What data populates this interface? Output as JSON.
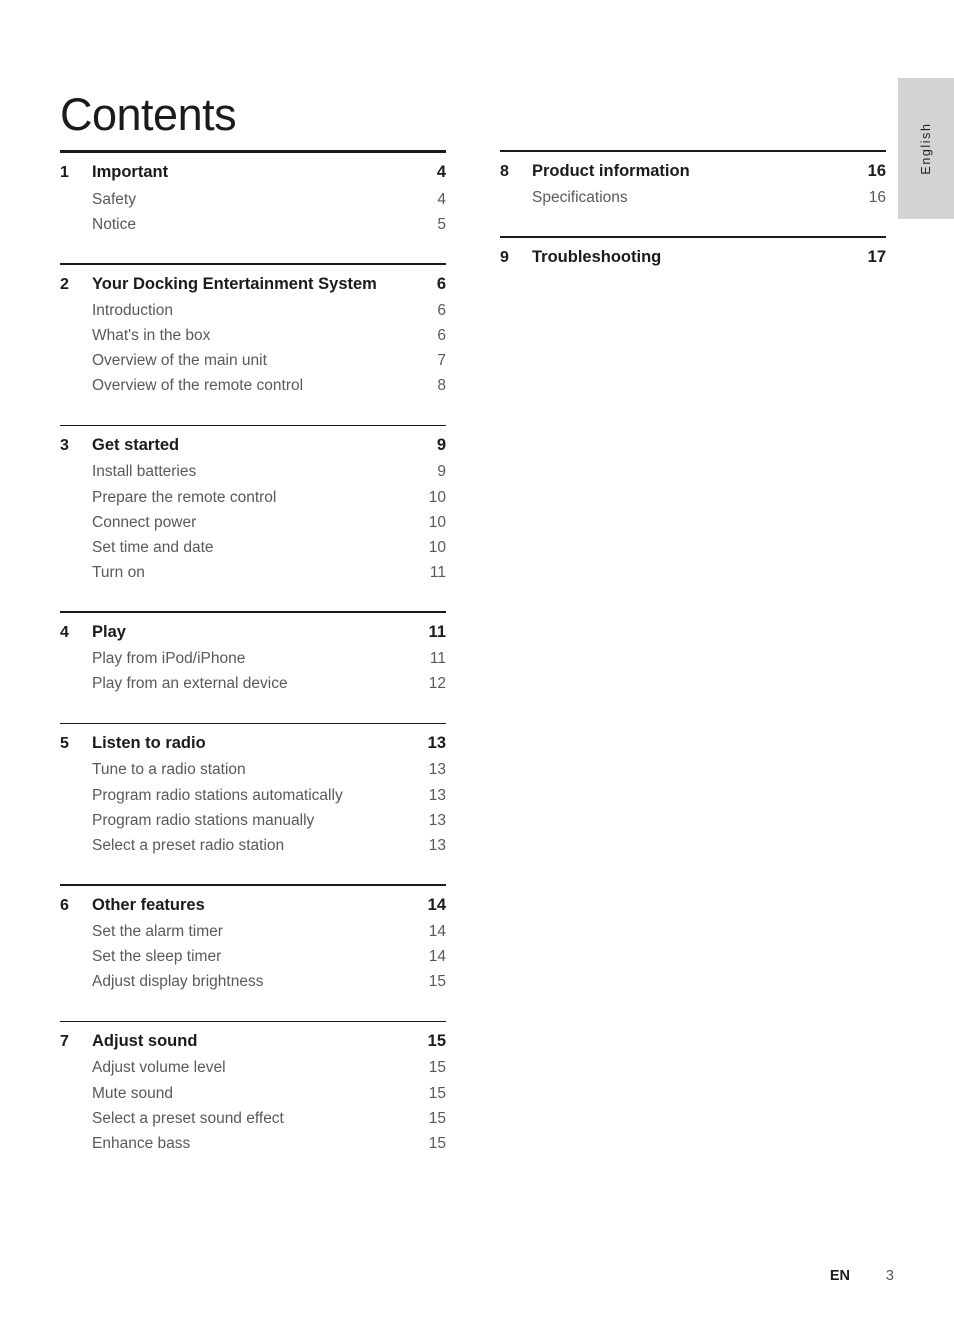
{
  "title": "Contents",
  "language_tab": {
    "label": "English"
  },
  "footer": {
    "lang_code": "EN",
    "page_number": "3"
  },
  "columns": {
    "left": [
      {
        "rule": "thick",
        "number": "1",
        "title": "Important",
        "page": "4",
        "items": [
          {
            "label": "Safety",
            "page": "4"
          },
          {
            "label": "Notice",
            "page": "5"
          }
        ]
      },
      {
        "rule": "thin",
        "number": "2",
        "title": "Your Docking Entertainment System",
        "page": "6",
        "tight": true,
        "items": [
          {
            "label": "Introduction",
            "page": "6"
          },
          {
            "label": "What's in the box",
            "page": "6"
          },
          {
            "label": "Overview of the main unit",
            "page": "7"
          },
          {
            "label": "Overview of the remote control",
            "page": "8"
          }
        ]
      },
      {
        "rule": "thin",
        "number": "3",
        "title": "Get started",
        "page": "9",
        "items": [
          {
            "label": "Install batteries",
            "page": "9"
          },
          {
            "label": "Prepare the remote control",
            "page": "10"
          },
          {
            "label": "Connect power",
            "page": "10"
          },
          {
            "label": "Set time and date",
            "page": "10"
          },
          {
            "label": "Turn on",
            "page": "11"
          }
        ]
      },
      {
        "rule": "thin",
        "number": "4",
        "title": "Play",
        "page": "11",
        "items": [
          {
            "label": "Play from iPod/iPhone",
            "page": "11"
          },
          {
            "label": "Play from an external device",
            "page": "12"
          }
        ]
      },
      {
        "rule": "thin",
        "number": "5",
        "title": "Listen to radio",
        "page": "13",
        "items": [
          {
            "label": "Tune to a radio station",
            "page": "13"
          },
          {
            "label": "Program radio stations automatically",
            "page": "13"
          },
          {
            "label": "Program radio stations manually",
            "page": "13"
          },
          {
            "label": "Select a preset radio station",
            "page": "13"
          }
        ]
      },
      {
        "rule": "thin",
        "number": "6",
        "title": "Other features",
        "page": "14",
        "items": [
          {
            "label": "Set the alarm timer",
            "page": "14"
          },
          {
            "label": "Set the sleep timer",
            "page": "14"
          },
          {
            "label": "Adjust display brightness",
            "page": "15"
          }
        ]
      },
      {
        "rule": "thin",
        "number": "7",
        "title": "Adjust sound",
        "page": "15",
        "items": [
          {
            "label": "Adjust volume level",
            "page": "15"
          },
          {
            "label": "Mute sound",
            "page": "15"
          },
          {
            "label": "Select a preset sound effect",
            "page": "15"
          },
          {
            "label": "Enhance bass",
            "page": "15"
          }
        ]
      }
    ],
    "right": [
      {
        "rule": "thin",
        "number": "8",
        "title": "Product information",
        "page": "16",
        "items": [
          {
            "label": "Specifications",
            "page": "16"
          }
        ]
      },
      {
        "rule": "thin",
        "number": "9",
        "title": "Troubleshooting",
        "page": "17",
        "items": []
      }
    ]
  }
}
